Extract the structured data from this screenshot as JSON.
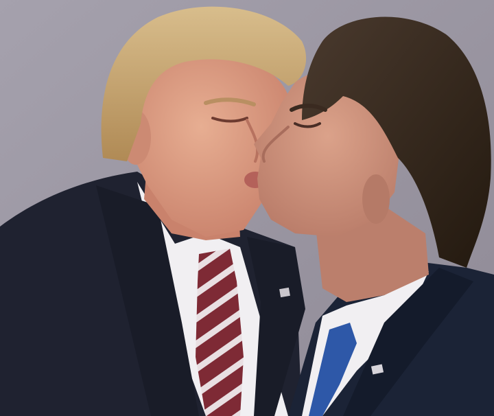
{
  "photo": {
    "subjects": [
      {
        "role": "left-figure",
        "attire": [
          "dark-suit",
          "white-shirt",
          "striped-red-white-tie",
          "flag-lapel-pin"
        ]
      },
      {
        "role": "right-figure",
        "attire": [
          "dark-navy-suit",
          "white-shirt",
          "blue-tie",
          "flag-lapel-pin"
        ]
      }
    ],
    "colors": {
      "backdrop": "#9c97a3",
      "left_hair": "#c9a873",
      "right_hair": "#3a2c22",
      "left_skin": "#d8957c",
      "right_skin": "#c98c77",
      "left_suit": "#1f2230",
      "right_suit": "#1b2336",
      "shirt": "#f1eff2",
      "tie_red": "#7e2a35",
      "tie_white": "#e9dfe2",
      "tie_blue": "#2e58a8"
    }
  }
}
